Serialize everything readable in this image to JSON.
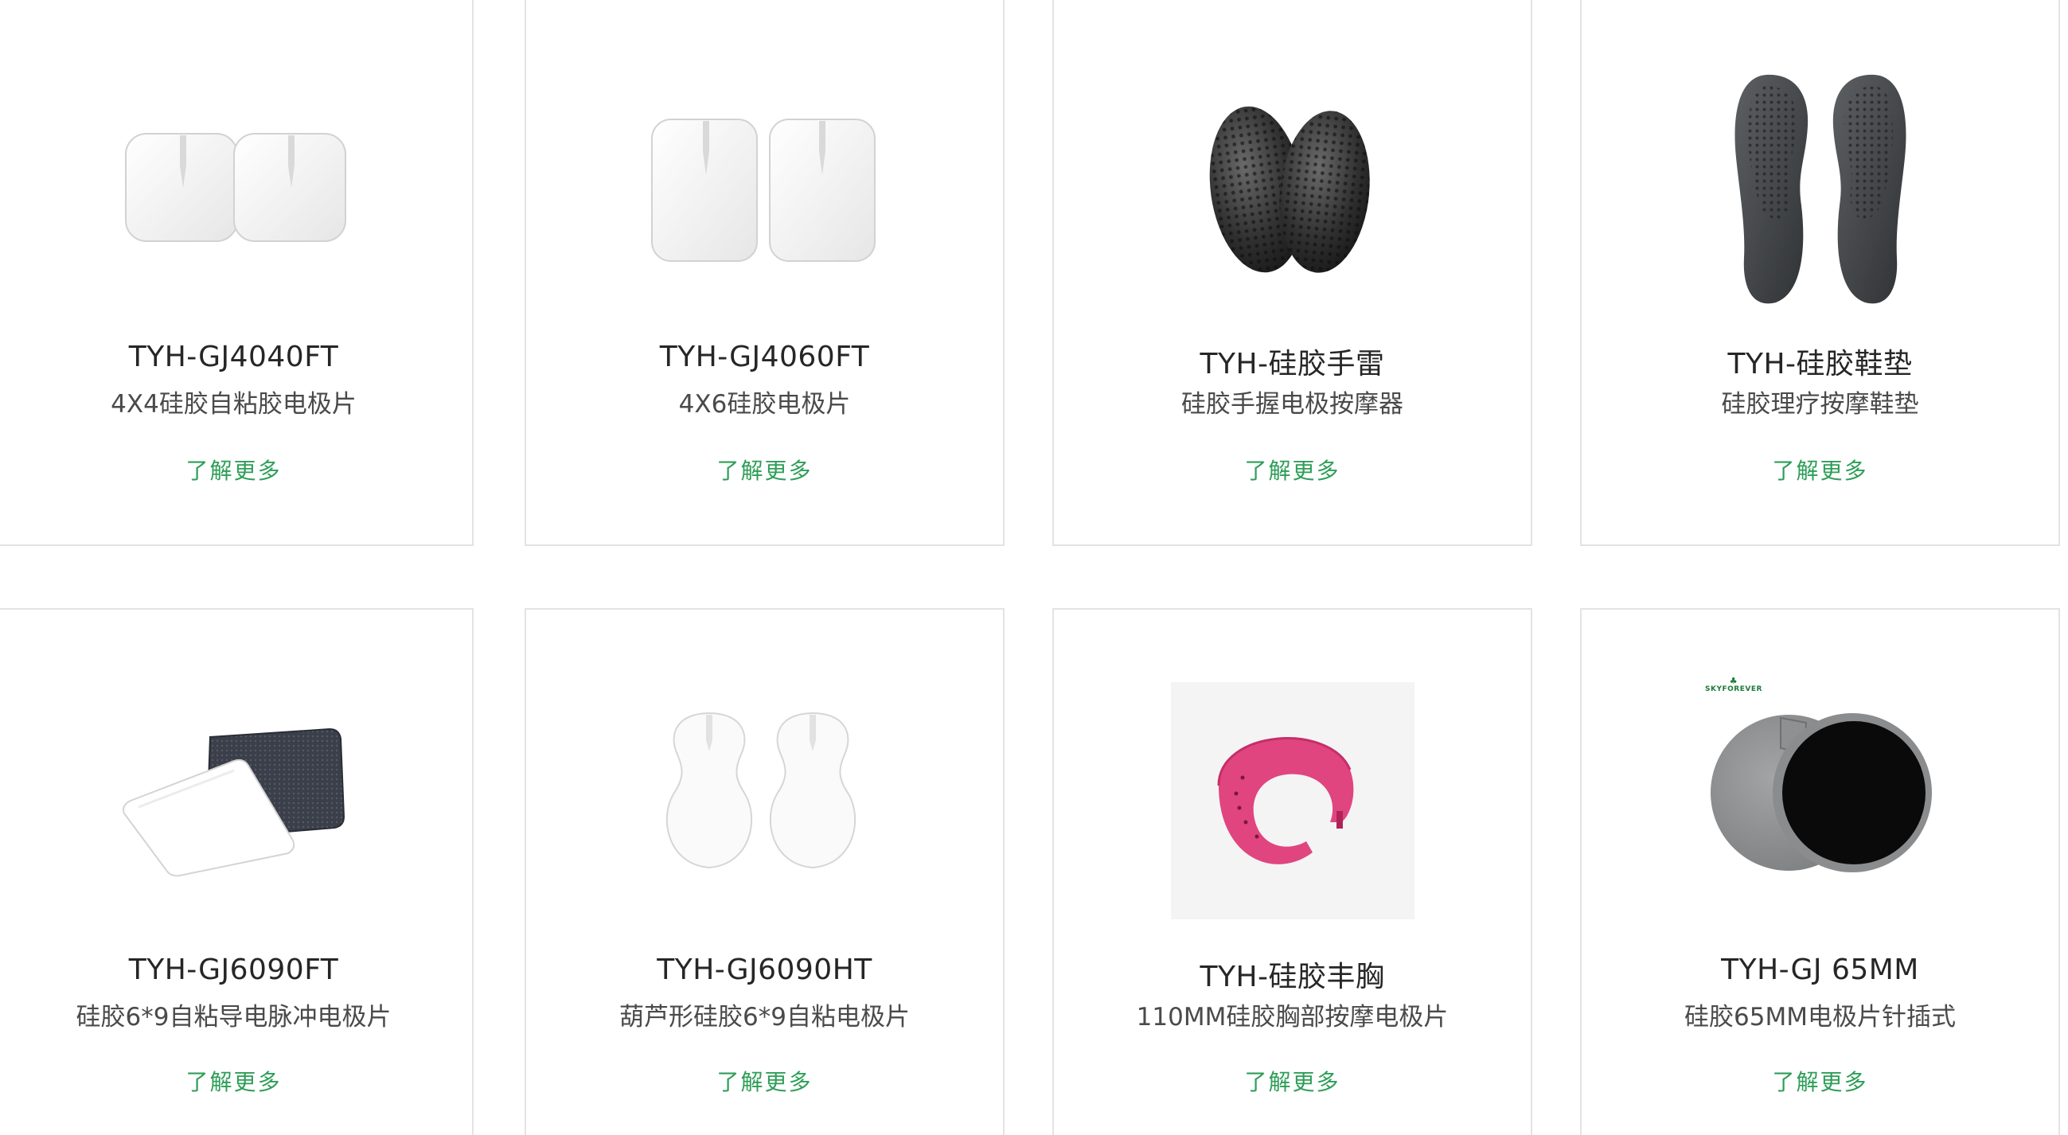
{
  "products": [
    {
      "model": "TYH-GJ4040FT",
      "desc": "4X4硅胶自粘胶电极片",
      "more": "了解更多",
      "icon": "square-electrode-pads-image"
    },
    {
      "model": "TYH-GJ4060FT",
      "desc": "4X6硅胶电极片",
      "more": "了解更多",
      "icon": "rect-electrode-pads-image"
    },
    {
      "model": "TYH-硅胶手雷",
      "desc": "硅胶手握电极按摩器",
      "more": "了解更多",
      "icon": "grip-massager-image"
    },
    {
      "model": "TYH-硅胶鞋垫",
      "desc": "硅胶理疗按摩鞋垫",
      "more": "了解更多",
      "icon": "insole-image"
    },
    {
      "model": "TYH-GJ6090FT",
      "desc": "硅胶6*9自粘导电脉冲电极片",
      "more": "了解更多",
      "icon": "large-electrode-pads-image"
    },
    {
      "model": "TYH-GJ6090HT",
      "desc": "葫芦形硅胶6*9自粘电极片",
      "more": "了解更多",
      "icon": "gourd-electrode-pads-image"
    },
    {
      "model": "TYH-硅胶丰胸",
      "desc": "110MM硅胶胸部按摩电极片",
      "more": "了解更多",
      "icon": "breast-massage-pad-image"
    },
    {
      "model": "TYH-GJ 65MM",
      "desc": "硅胶65MM电极片针插式",
      "more": "了解更多",
      "icon": "round-electrode-pads-image",
      "watermark": "SKYFOREVER"
    }
  ],
  "colors": {
    "link": "#2e9e58",
    "border": "#e3e3e3",
    "title": "#262626",
    "desc": "#4a4a4a"
  }
}
